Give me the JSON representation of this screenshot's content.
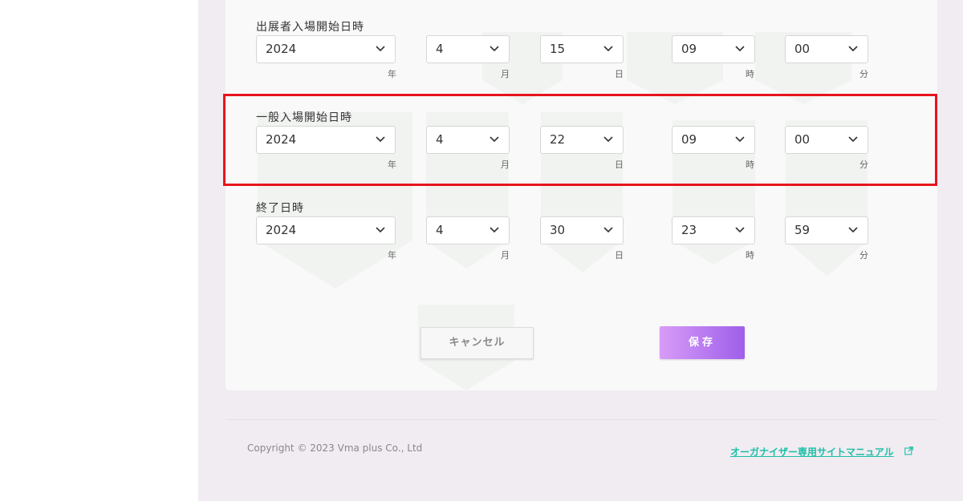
{
  "sections": [
    {
      "label": "出展者入場開始日時",
      "year": "2024",
      "month": "4",
      "day": "15",
      "hour": "09",
      "minute": "00"
    },
    {
      "label": "一般入場開始日時",
      "year": "2024",
      "month": "4",
      "day": "22",
      "hour": "09",
      "minute": "00"
    },
    {
      "label": "終了日時",
      "year": "2024",
      "month": "4",
      "day": "30",
      "hour": "23",
      "minute": "59"
    }
  ],
  "units": {
    "year": "年",
    "month": "月",
    "day": "日",
    "hour": "時",
    "minute": "分"
  },
  "buttons": {
    "cancel": "キャンセル",
    "save": "保存"
  },
  "footer": {
    "copyright": "Copyright © 2023 Vma plus Co., Ltd",
    "manual_link": "オーガナイザー専用サイトマニュアル"
  },
  "icons": {
    "select_arrow": "chevron-down-icon",
    "external": "external-link-icon"
  },
  "colors": {
    "accent": "#b87af0",
    "link": "#1cbfa6",
    "highlight": "#e8141c"
  }
}
